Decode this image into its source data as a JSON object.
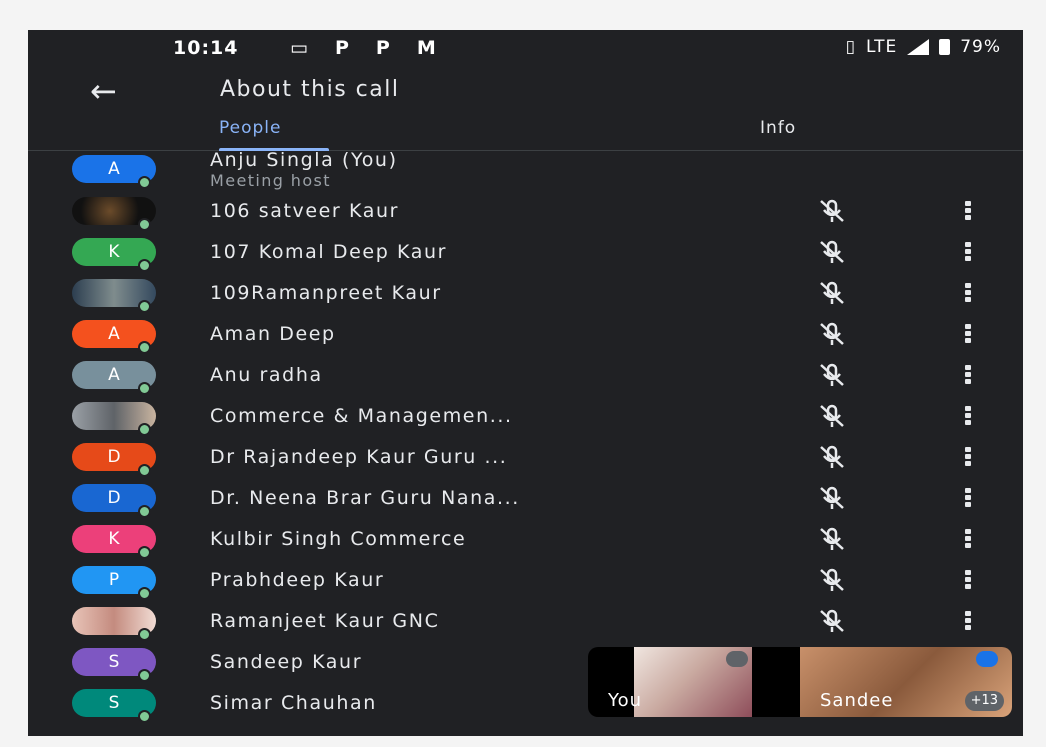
{
  "status": {
    "time": "10:14",
    "left_icons": [
      "▭",
      "P",
      "P",
      "M"
    ],
    "network": "LTE",
    "battery": "79%"
  },
  "header": {
    "title": "About this call"
  },
  "tabs": [
    {
      "label": "People",
      "active": true
    },
    {
      "label": "Info",
      "active": false
    }
  ],
  "participants": [
    {
      "name": "Anju Singla (You)",
      "subtitle": "Meeting host",
      "initial": "A",
      "color": "#1a73e8",
      "photo": false
    },
    {
      "name": "106 satveer Kaur",
      "initial": "",
      "color": "#111111",
      "photo": "dark"
    },
    {
      "name": "107 Komal Deep Kaur",
      "initial": "K",
      "color": "#34a853",
      "photo": false
    },
    {
      "name": "109Ramanpreet Kaur",
      "initial": "",
      "color": "#2c3e50",
      "photo": "blue"
    },
    {
      "name": "Aman Deep",
      "initial": "A",
      "color": "#f4511e",
      "photo": false
    },
    {
      "name": "Anu radha",
      "initial": "A",
      "color": "#78909c",
      "photo": false
    },
    {
      "name": "Commerce & Managemen...",
      "initial": "",
      "color": "#9aa0a6",
      "photo": "grey"
    },
    {
      "name": "Dr Rajandeep Kaur Guru ...",
      "initial": "D",
      "color": "#e64a19",
      "photo": false
    },
    {
      "name": "Dr. Neena Brar Guru Nana...",
      "initial": "D",
      "color": "#1967d2",
      "photo": false
    },
    {
      "name": "Kulbir Singh Commerce",
      "initial": "K",
      "color": "#ec407a",
      "photo": false
    },
    {
      "name": "Prabhdeep Kaur",
      "initial": "P",
      "color": "#2196f3",
      "photo": false
    },
    {
      "name": "Ramanjeet Kaur GNC",
      "initial": "",
      "color": "#e8c4b8",
      "photo": "pink"
    },
    {
      "name": "Sandeep Kaur",
      "initial": "S",
      "color": "#7e57c2",
      "photo": false
    },
    {
      "name": "Simar Chauhan",
      "initial": "S",
      "color": "#00897b",
      "photo": false
    }
  ],
  "pip": {
    "self_label": "You",
    "other_label": "Sandee",
    "more_count": "+13"
  }
}
